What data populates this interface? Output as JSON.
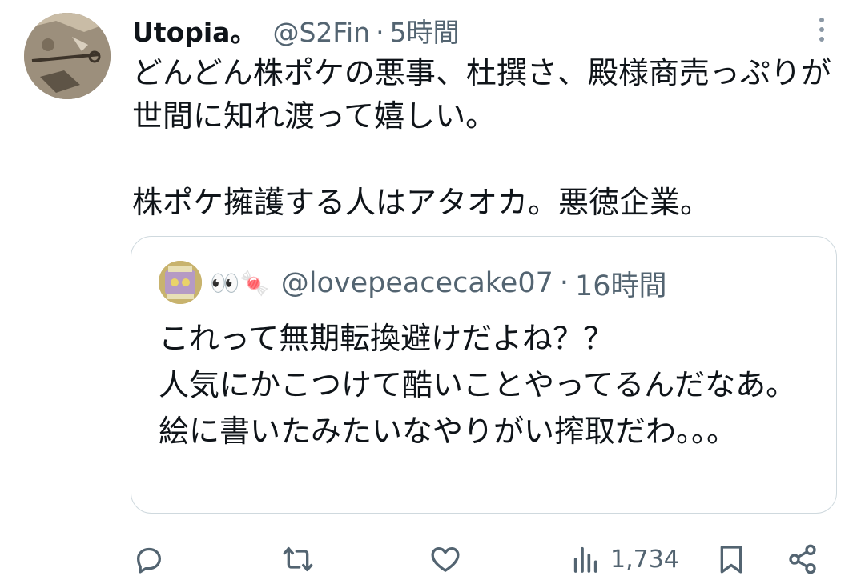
{
  "tweet": {
    "display_name": "Utopia。",
    "handle": "@S2Fin",
    "separator": "·",
    "time": "5時間",
    "body": "どんどん株ポケの悪事、杜撰さ、殿様商売っぷりが世間に知れ渡って嬉しい。\n\n株ポケ擁護する人はアタオカ。悪徳企業。"
  },
  "quote": {
    "emoji": "👀🍬",
    "handle": "@lovepeacecake07",
    "separator": "·",
    "time": "16時間",
    "body": "これって無期転換避けだよね？？\n人気にかこつけて酷いことやってるんだなあ。絵に書いたみたいなやりがい搾取だわ。。。"
  },
  "actions": {
    "views": "1,734",
    "icons": [
      "reply-icon",
      "retweet-icon",
      "like-icon",
      "views-icon",
      "bookmark-icon",
      "share-icon"
    ]
  },
  "colors": {
    "text": "#0f1419",
    "secondary": "#536471",
    "border": "#cfd9de"
  }
}
